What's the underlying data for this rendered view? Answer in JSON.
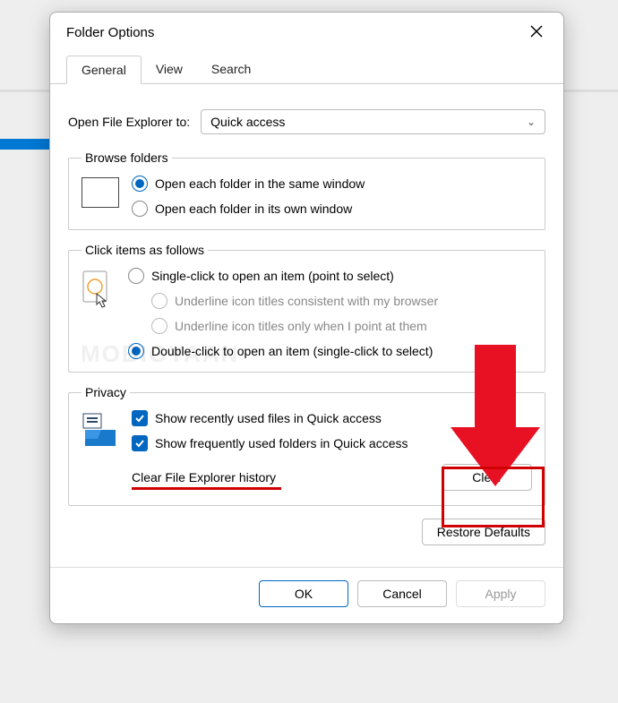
{
  "window": {
    "title": "Folder Options"
  },
  "tabs": {
    "general": "General",
    "view": "View",
    "search": "Search"
  },
  "open_to": {
    "label": "Open File Explorer to:",
    "value": "Quick access"
  },
  "browse": {
    "legend": "Browse folders",
    "same": "Open each folder in the same window",
    "own": "Open each folder in its own window"
  },
  "click": {
    "legend": "Click items as follows",
    "single": "Single-click to open an item (point to select)",
    "u1": "Underline icon titles consistent with my browser",
    "u2": "Underline icon titles only when I point at them",
    "dbl": "Double-click to open an item (single-click to select)"
  },
  "privacy": {
    "legend": "Privacy",
    "recent": "Show recently used files in Quick access",
    "freq": "Show frequently used folders in Quick access",
    "clear_label": "Clear File Explorer history",
    "clear_btn": "Clear"
  },
  "buttons": {
    "restore": "Restore Defaults",
    "ok": "OK",
    "cancel": "Cancel",
    "apply": "Apply"
  },
  "watermark": "MOBIGYAAN"
}
